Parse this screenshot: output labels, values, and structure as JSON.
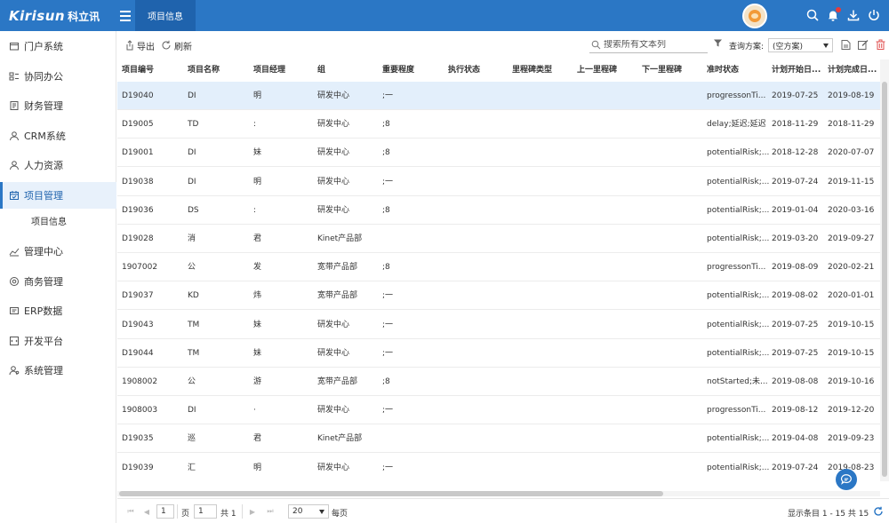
{
  "app": {
    "logo_text": "Kirisun",
    "logo_cn": "科立讯",
    "active_tab": "项目信息"
  },
  "colors": {
    "primary": "#2b77c5",
    "tab_active": "#1f63ad",
    "selected_row": "#e3effb",
    "notification": "#e83a3a",
    "delete": "#e05252"
  },
  "header_icons": [
    "menu-icon",
    "search-icon",
    "bell-icon",
    "download-icon",
    "power-icon"
  ],
  "sidebar": {
    "items": [
      {
        "label": "门户系统",
        "icon": "portal-icon"
      },
      {
        "label": "协同办公",
        "icon": "collab-icon"
      },
      {
        "label": "财务管理",
        "icon": "finance-icon"
      },
      {
        "label": "CRM系统",
        "icon": "crm-icon"
      },
      {
        "label": "人力资源",
        "icon": "hr-icon"
      },
      {
        "label": "项目管理",
        "icon": "calendar-icon",
        "active": true
      },
      {
        "label": "管理中心",
        "icon": "chart-icon"
      },
      {
        "label": "商务管理",
        "icon": "business-icon"
      },
      {
        "label": "ERP数据",
        "icon": "erp-icon"
      },
      {
        "label": "开发平台",
        "icon": "dev-icon"
      },
      {
        "label": "系统管理",
        "icon": "system-icon"
      }
    ],
    "sub_items": [
      {
        "label": "项目信息"
      }
    ]
  },
  "toolbar": {
    "export_label": "导出",
    "refresh_label": "刷新",
    "search_placeholder": "搜索所有文本列",
    "scheme_label": "查询方案:",
    "scheme_value": "(空方案)"
  },
  "table": {
    "columns": [
      "项目编号",
      "项目名称",
      "项目经理",
      "组",
      "重要程度",
      "执行状态",
      "里程碑类型",
      "上一里程碑",
      "下一里程碑",
      "准时状态",
      "计划开始日...",
      "计划完成日..."
    ],
    "rows": [
      [
        "D19040",
        "DI",
        "明",
        "研发中心",
        ";一",
        "",
        "",
        "",
        "",
        "progressonTi...",
        "2019-07-25",
        "2019-08-19"
      ],
      [
        "D19005",
        "TD",
        ":",
        "研发中心",
        ";8",
        "",
        "",
        "",
        "",
        "delay;延迟;延迟",
        "2018-11-29",
        "2018-11-29"
      ],
      [
        "D19001",
        "DI",
        "妹",
        "研发中心",
        ";8",
        "",
        "",
        "",
        "",
        "potentialRisk;...",
        "2018-12-28",
        "2020-07-07"
      ],
      [
        "D19038",
        "DI",
        "明",
        "研发中心",
        ";一",
        "",
        "",
        "",
        "",
        "potentialRisk;...",
        "2019-07-24",
        "2019-11-15"
      ],
      [
        "D19036",
        "DS",
        ":",
        "研发中心",
        ";8",
        "",
        "",
        "",
        "",
        "potentialRisk;...",
        "2019-01-04",
        "2020-03-16"
      ],
      [
        "D19028",
        "消",
        "君",
        "Kinet产品部",
        "",
        "",
        "",
        "",
        "",
        "potentialRisk;...",
        "2019-03-20",
        "2019-09-27"
      ],
      [
        "1907002",
        "公",
        "发",
        "宽带产品部",
        ";8",
        "",
        "",
        "",
        "",
        "progressonTi...",
        "2019-08-09",
        "2020-02-21"
      ],
      [
        "D19037",
        "KD",
        "炜",
        "宽带产品部",
        ";一",
        "",
        "",
        "",
        "",
        "potentialRisk;...",
        "2019-08-02",
        "2020-01-01"
      ],
      [
        "D19043",
        "TM",
        "妹",
        "研发中心",
        ";一",
        "",
        "",
        "",
        "",
        "potentialRisk;...",
        "2019-07-25",
        "2019-10-15"
      ],
      [
        "D19044",
        "TM",
        "妹",
        "研发中心",
        ";一",
        "",
        "",
        "",
        "",
        "potentialRisk;...",
        "2019-07-25",
        "2019-10-15"
      ],
      [
        "1908002",
        "公",
        "游",
        "宽带产品部",
        ";8",
        "",
        "",
        "",
        "",
        "notStarted;未...",
        "2019-08-08",
        "2019-10-16"
      ],
      [
        "1908003",
        "DI",
        "·",
        "研发中心",
        ";一",
        "",
        "",
        "",
        "",
        "progressonTi...",
        "2019-08-12",
        "2019-12-20"
      ],
      [
        "D19035",
        "巡",
        "君",
        "Kinet产品部",
        "",
        "",
        "",
        "",
        "",
        "potentialRisk;...",
        "2019-04-08",
        "2019-09-23"
      ],
      [
        "D19039",
        "汇",
        "明",
        "研发中心",
        ";一",
        "",
        "",
        "",
        "",
        "potentialRisk;...",
        "2019-07-24",
        "2019-08-23"
      ]
    ]
  },
  "pager": {
    "first": "⏮",
    "prev": "◀",
    "current_page": "1",
    "page_label": "页",
    "page_input": "1",
    "total_label": "共 1",
    "next": "▶",
    "last": "⏭",
    "page_size": "20",
    "per_page_label": "每页",
    "summary": "显示条目 1 - 15 共 15"
  }
}
